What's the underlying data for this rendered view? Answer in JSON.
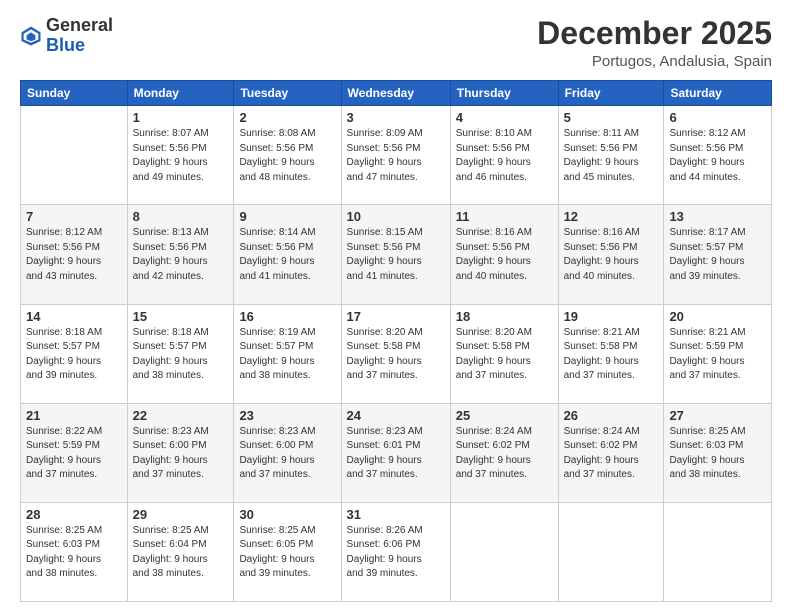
{
  "logo": {
    "general": "General",
    "blue": "Blue"
  },
  "header": {
    "month": "December 2025",
    "location": "Portugos, Andalusia, Spain"
  },
  "weekdays": [
    "Sunday",
    "Monday",
    "Tuesday",
    "Wednesday",
    "Thursday",
    "Friday",
    "Saturday"
  ],
  "weeks": [
    [
      {
        "day": "",
        "info": ""
      },
      {
        "day": "1",
        "info": "Sunrise: 8:07 AM\nSunset: 5:56 PM\nDaylight: 9 hours\nand 49 minutes."
      },
      {
        "day": "2",
        "info": "Sunrise: 8:08 AM\nSunset: 5:56 PM\nDaylight: 9 hours\nand 48 minutes."
      },
      {
        "day": "3",
        "info": "Sunrise: 8:09 AM\nSunset: 5:56 PM\nDaylight: 9 hours\nand 47 minutes."
      },
      {
        "day": "4",
        "info": "Sunrise: 8:10 AM\nSunset: 5:56 PM\nDaylight: 9 hours\nand 46 minutes."
      },
      {
        "day": "5",
        "info": "Sunrise: 8:11 AM\nSunset: 5:56 PM\nDaylight: 9 hours\nand 45 minutes."
      },
      {
        "day": "6",
        "info": "Sunrise: 8:12 AM\nSunset: 5:56 PM\nDaylight: 9 hours\nand 44 minutes."
      }
    ],
    [
      {
        "day": "7",
        "info": "Sunrise: 8:12 AM\nSunset: 5:56 PM\nDaylight: 9 hours\nand 43 minutes."
      },
      {
        "day": "8",
        "info": "Sunrise: 8:13 AM\nSunset: 5:56 PM\nDaylight: 9 hours\nand 42 minutes."
      },
      {
        "day": "9",
        "info": "Sunrise: 8:14 AM\nSunset: 5:56 PM\nDaylight: 9 hours\nand 41 minutes."
      },
      {
        "day": "10",
        "info": "Sunrise: 8:15 AM\nSunset: 5:56 PM\nDaylight: 9 hours\nand 41 minutes."
      },
      {
        "day": "11",
        "info": "Sunrise: 8:16 AM\nSunset: 5:56 PM\nDaylight: 9 hours\nand 40 minutes."
      },
      {
        "day": "12",
        "info": "Sunrise: 8:16 AM\nSunset: 5:56 PM\nDaylight: 9 hours\nand 40 minutes."
      },
      {
        "day": "13",
        "info": "Sunrise: 8:17 AM\nSunset: 5:57 PM\nDaylight: 9 hours\nand 39 minutes."
      }
    ],
    [
      {
        "day": "14",
        "info": "Sunrise: 8:18 AM\nSunset: 5:57 PM\nDaylight: 9 hours\nand 39 minutes."
      },
      {
        "day": "15",
        "info": "Sunrise: 8:18 AM\nSunset: 5:57 PM\nDaylight: 9 hours\nand 38 minutes."
      },
      {
        "day": "16",
        "info": "Sunrise: 8:19 AM\nSunset: 5:57 PM\nDaylight: 9 hours\nand 38 minutes."
      },
      {
        "day": "17",
        "info": "Sunrise: 8:20 AM\nSunset: 5:58 PM\nDaylight: 9 hours\nand 37 minutes."
      },
      {
        "day": "18",
        "info": "Sunrise: 8:20 AM\nSunset: 5:58 PM\nDaylight: 9 hours\nand 37 minutes."
      },
      {
        "day": "19",
        "info": "Sunrise: 8:21 AM\nSunset: 5:58 PM\nDaylight: 9 hours\nand 37 minutes."
      },
      {
        "day": "20",
        "info": "Sunrise: 8:21 AM\nSunset: 5:59 PM\nDaylight: 9 hours\nand 37 minutes."
      }
    ],
    [
      {
        "day": "21",
        "info": "Sunrise: 8:22 AM\nSunset: 5:59 PM\nDaylight: 9 hours\nand 37 minutes."
      },
      {
        "day": "22",
        "info": "Sunrise: 8:23 AM\nSunset: 6:00 PM\nDaylight: 9 hours\nand 37 minutes."
      },
      {
        "day": "23",
        "info": "Sunrise: 8:23 AM\nSunset: 6:00 PM\nDaylight: 9 hours\nand 37 minutes."
      },
      {
        "day": "24",
        "info": "Sunrise: 8:23 AM\nSunset: 6:01 PM\nDaylight: 9 hours\nand 37 minutes."
      },
      {
        "day": "25",
        "info": "Sunrise: 8:24 AM\nSunset: 6:02 PM\nDaylight: 9 hours\nand 37 minutes."
      },
      {
        "day": "26",
        "info": "Sunrise: 8:24 AM\nSunset: 6:02 PM\nDaylight: 9 hours\nand 37 minutes."
      },
      {
        "day": "27",
        "info": "Sunrise: 8:25 AM\nSunset: 6:03 PM\nDaylight: 9 hours\nand 38 minutes."
      }
    ],
    [
      {
        "day": "28",
        "info": "Sunrise: 8:25 AM\nSunset: 6:03 PM\nDaylight: 9 hours\nand 38 minutes."
      },
      {
        "day": "29",
        "info": "Sunrise: 8:25 AM\nSunset: 6:04 PM\nDaylight: 9 hours\nand 38 minutes."
      },
      {
        "day": "30",
        "info": "Sunrise: 8:25 AM\nSunset: 6:05 PM\nDaylight: 9 hours\nand 39 minutes."
      },
      {
        "day": "31",
        "info": "Sunrise: 8:26 AM\nSunset: 6:06 PM\nDaylight: 9 hours\nand 39 minutes."
      },
      {
        "day": "",
        "info": ""
      },
      {
        "day": "",
        "info": ""
      },
      {
        "day": "",
        "info": ""
      }
    ]
  ]
}
